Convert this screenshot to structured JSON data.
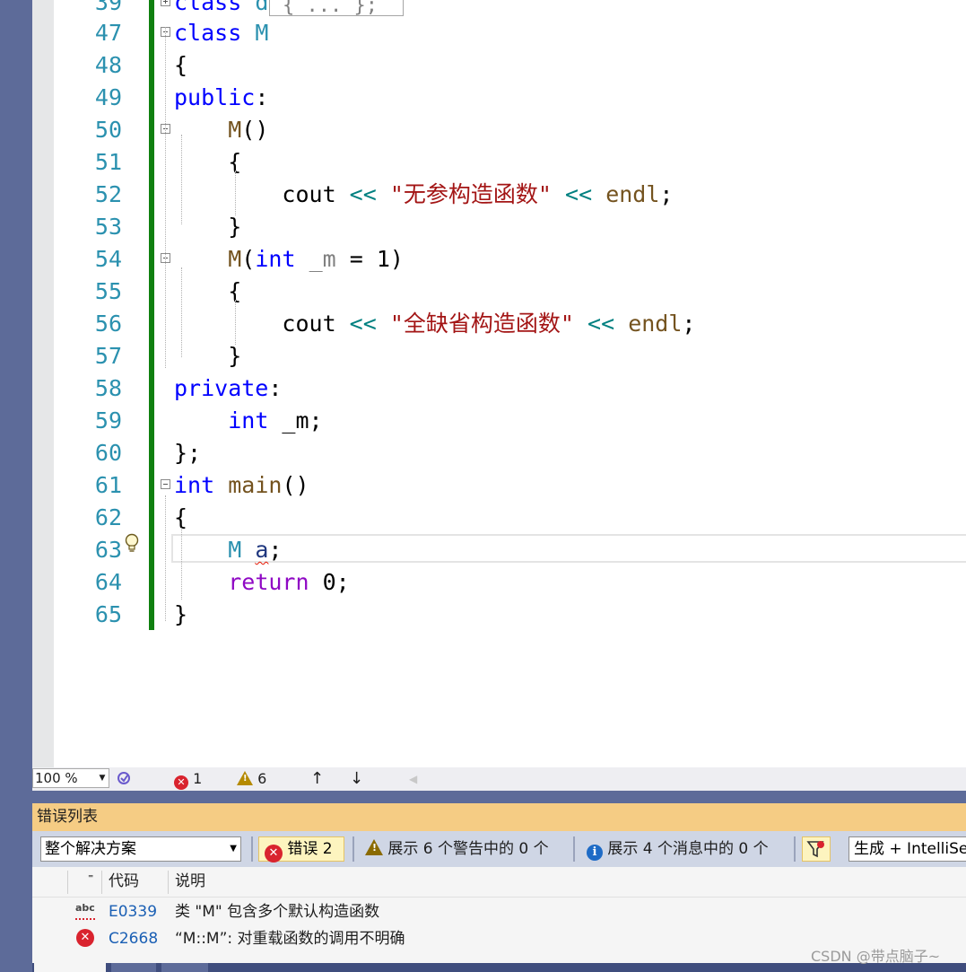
{
  "editor": {
    "collapsed_preview": "{ ... };",
    "lines": [
      {
        "num": "39",
        "html": "<span class='kw'>class</span> <span class='ty'>d</span>"
      },
      {
        "num": "47",
        "html": "<span class='kw'>class</span> <span class='ty'>M</span>"
      },
      {
        "num": "48",
        "html": "{"
      },
      {
        "num": "49",
        "html": "<span class='kw'>public</span>:"
      },
      {
        "num": "50",
        "html": "    <span class='fn'>M</span>()"
      },
      {
        "num": "51",
        "html": "    {"
      },
      {
        "num": "52",
        "html": "        cout <span class='op'>&lt;&lt;</span> <span class='st'>\"无参构造函数\"</span> <span class='op'>&lt;&lt;</span> <span class='fn'>endl</span>;"
      },
      {
        "num": "53",
        "html": "    }"
      },
      {
        "num": "54",
        "html": "    <span class='fn'>M</span>(<span class='kw'>int</span> <span class='gray'>_m</span> = 1)"
      },
      {
        "num": "55",
        "html": "    {"
      },
      {
        "num": "56",
        "html": "        cout <span class='op'>&lt;&lt;</span> <span class='st'>\"全缺省构造函数\"</span> <span class='op'>&lt;&lt;</span> <span class='fn'>endl</span>;"
      },
      {
        "num": "57",
        "html": "    }"
      },
      {
        "num": "58",
        "html": "<span class='kw'>private</span>:"
      },
      {
        "num": "59",
        "html": "    <span class='kw'>int</span> _m;"
      },
      {
        "num": "60",
        "html": "};"
      },
      {
        "num": "61",
        "html": "<span class='kw'>int</span> <span class='fn'>main</span>()"
      },
      {
        "num": "62",
        "html": "{"
      },
      {
        "num": "63",
        "html": "    <span class='ty'>M</span> <span class='var squiggle'>a</span>;"
      },
      {
        "num": "64",
        "html": "    <span class='ctrl'>return</span> 0;"
      },
      {
        "num": "65",
        "html": "}"
      }
    ]
  },
  "status_bar": {
    "zoom": "100 %",
    "error_count": "1",
    "warning_count": "6"
  },
  "error_list": {
    "title": "错误列表",
    "scope": "整个解决方案",
    "errors_filter": "错误 2",
    "warnings_filter": "展示 6 个警告中的 0 个",
    "messages_filter": "展示 4 个消息中的 0 个",
    "build_source": "生成 + IntelliSense",
    "columns": {
      "code": "代码",
      "description": "说明"
    },
    "rows": [
      {
        "icon": "spell-error-icon",
        "code": "E0339",
        "description": "类 \"M\" 包含多个默认构造函数"
      },
      {
        "icon": "error-icon",
        "code": "C2668",
        "description": "“M::M”: 对重载函数的调用不明确"
      }
    ]
  },
  "watermark": "CSDN @带点脑子~",
  "colors": {
    "keyword": "#0000ff",
    "type": "#2b91af",
    "function": "#74531f",
    "string": "#a31515",
    "operator": "#008080",
    "control": "#8f08c4",
    "change_bar": "#108010",
    "panel_title_bg": "#f5cc84"
  }
}
